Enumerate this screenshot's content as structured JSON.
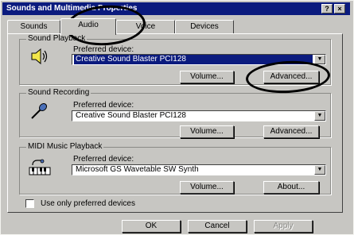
{
  "window": {
    "title": "Sounds and Multimedia Properties",
    "help_btn": "?",
    "close_btn": "×"
  },
  "tabs": [
    {
      "label": "Sounds",
      "active": false
    },
    {
      "label": "Audio",
      "active": true
    },
    {
      "label": "Voice",
      "active": false
    },
    {
      "label": "Devices",
      "active": false
    }
  ],
  "groups": {
    "playback": {
      "title": "Sound Playback",
      "icon": "speaker-icon",
      "preferred_label": "Preferred device:",
      "device": "Creative Sound Blaster PCI128",
      "volume_label": "Volume...",
      "advanced_label": "Advanced..."
    },
    "recording": {
      "title": "Sound Recording",
      "icon": "microphone-icon",
      "preferred_label": "Preferred device:",
      "device": "Creative Sound Blaster PCI128",
      "volume_label": "Volume...",
      "advanced_label": "Advanced..."
    },
    "midi": {
      "title": "MIDI Music Playback",
      "icon": "keyboard-icon",
      "preferred_label": "Preferred device:",
      "device": "Microsoft GS Wavetable SW Synth",
      "volume_label": "Volume...",
      "about_label": "About..."
    }
  },
  "use_only_preferred": {
    "label": "Use only preferred devices",
    "checked": false
  },
  "footer": {
    "ok_label": "OK",
    "cancel_label": "Cancel",
    "apply_label": "Apply"
  },
  "colors": {
    "titlebar": "#0b1b7e",
    "face": "#c7c6c2",
    "selection": "#0b1b7e"
  }
}
